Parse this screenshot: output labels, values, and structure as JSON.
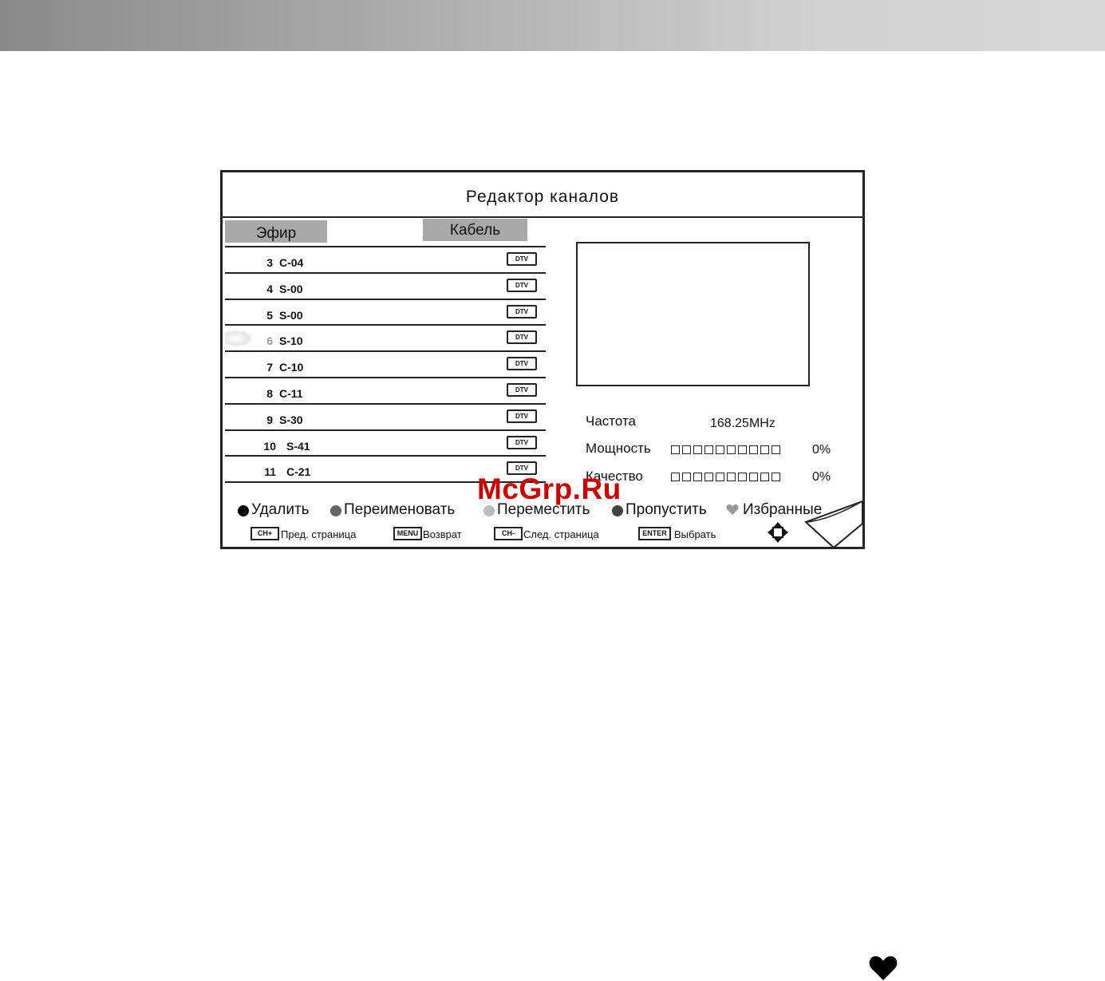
{
  "title": "Редактор каналов",
  "tabs": [
    {
      "label": "Эфир"
    },
    {
      "label": "Кабель"
    }
  ],
  "channels": [
    {
      "number": "3",
      "name": "C-04",
      "type": "DTV"
    },
    {
      "number": "4",
      "name": "S-00",
      "type": "DTV"
    },
    {
      "number": "5",
      "name": "S-00",
      "type": "DTV"
    },
    {
      "number": "6",
      "name": "S-10",
      "type": "DTV"
    },
    {
      "number": "7",
      "name": "C-10",
      "type": "DTV"
    },
    {
      "number": "8",
      "name": "C-11",
      "type": "DTV"
    },
    {
      "number": "9",
      "name": "S-30",
      "type": "DTV"
    },
    {
      "number": "10",
      "name": "S-41",
      "type": "DTV"
    },
    {
      "number": "11",
      "name": "C-21",
      "type": "DTV"
    }
  ],
  "selected_channel": "6",
  "info": {
    "frequency_label": "Частота",
    "frequency_value": "168.25MHz",
    "power_label": "Мощность",
    "power_value": "0%",
    "power_level": 0,
    "quality_label": "Качество",
    "quality_value": "0%",
    "quality_level": 0,
    "meter_segments": 10
  },
  "legend": [
    {
      "label": "Удалить",
      "color": "#000000",
      "icon": "dot"
    },
    {
      "label": "Переименовать",
      "color": "#666666",
      "icon": "dot"
    },
    {
      "label": "Переместить",
      "color": "#bbbbbb",
      "icon": "dot"
    },
    {
      "label": "Пропустить",
      "color": "#444444",
      "icon": "dot"
    },
    {
      "label": "Избранные",
      "color": "#999999",
      "icon": "heart"
    }
  ],
  "key_hints": [
    {
      "key": "CH+",
      "label": "Пред. страница"
    },
    {
      "key": "MENU",
      "label": "Возврат"
    },
    {
      "key": "CH-",
      "label": "След. страница"
    },
    {
      "key": "ENTER",
      "label": "Выбрать"
    }
  ],
  "watermark": "McGrp.Ru",
  "colors": {
    "header_gradient_start": "#8a8a8a",
    "header_gradient_end": "#d8d8d8",
    "tab_bg": "#a9a9a9",
    "watermark": "#d00000"
  }
}
